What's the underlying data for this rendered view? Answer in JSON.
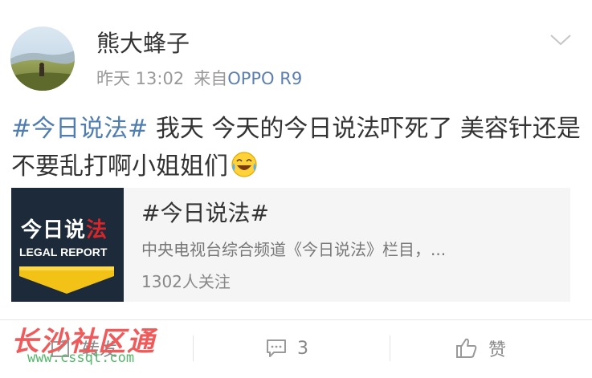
{
  "post": {
    "author": "熊大蜂子",
    "time": "昨天 13:02",
    "source_prefix": "来自",
    "device": "OPPO R9",
    "hashtag": "#今日说法#",
    "text_rest": " 我天 今天的今日说法吓死了 美容针还是不要乱打啊小姐姐们",
    "emoji": "laughing-tears-emoji"
  },
  "card": {
    "thumb_cn": "今日说",
    "thumb_cn_last": "法",
    "thumb_en": "LEGAL REPORT",
    "title": "#今日说法#",
    "description": "中央电视台综合频道《今日说法》栏目，...",
    "followers": "1302人关注"
  },
  "actions": {
    "repost_label": "转发",
    "comment_count": "3",
    "like_label": "赞"
  },
  "watermark": {
    "name": "长沙社区通",
    "url": "www.cssqt.com"
  },
  "colors": {
    "link_blue": "#507daf",
    "device_blue": "#5d7fad",
    "watermark_red": "#ef5a5a",
    "watermark_green": "#55b86a"
  }
}
